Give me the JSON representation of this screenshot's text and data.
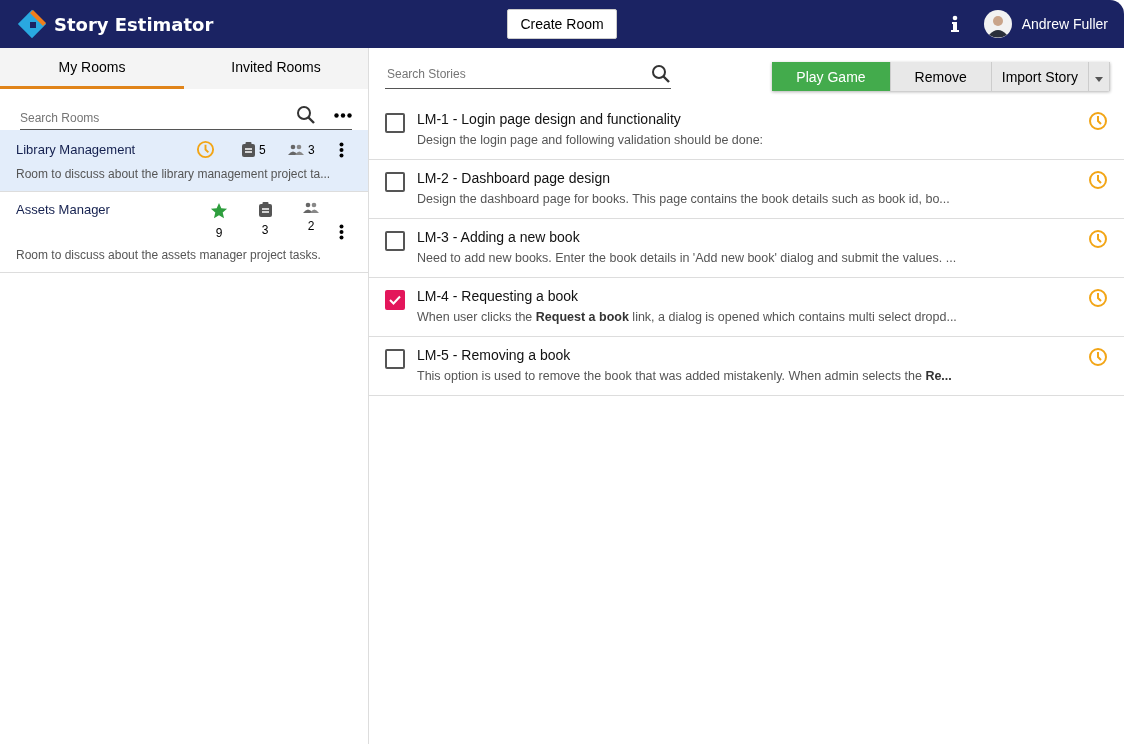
{
  "header": {
    "app_name": "Story Estimator",
    "create_button": "Create Room",
    "user_name": "Andrew Fuller"
  },
  "sidebar": {
    "tabs": [
      {
        "label": "My Rooms",
        "selected": true
      },
      {
        "label": "Invited Rooms",
        "selected": false
      }
    ],
    "search": {
      "placeholder": "Search Rooms"
    },
    "rooms": [
      {
        "name": "Library Management",
        "selected": true,
        "kind": "inline",
        "status": {
          "kind": "clock"
        },
        "stories": "5",
        "members": "3",
        "description": "Room to discuss about the library management project ta..."
      },
      {
        "name": "Assets Manager",
        "selected": false,
        "kind": "stacked",
        "status": {
          "kind": "star",
          "count": "9"
        },
        "stories": "3",
        "members": "2",
        "description": "Room to discuss about the assets manager project tasks."
      }
    ]
  },
  "main": {
    "search": {
      "placeholder": "Search Stories"
    },
    "buttons": [
      "Play Game",
      "Remove",
      "Import Story"
    ],
    "stories": [
      {
        "title": "LM-1 - Login page design and functionality",
        "checked": false,
        "description": "Design the login page and following validation should be done:"
      },
      {
        "title": "LM-2 - Dashboard page design",
        "checked": false,
        "description": "Design the dashboard page for books. This page contains the book details such as book id, bo..."
      },
      {
        "title": "LM-3 - Adding a new book",
        "checked": false,
        "description": "Need to add new books. Enter the book details in 'Add new book' dialog and submit the values. ..."
      },
      {
        "title": "LM-4 - Requesting a book",
        "checked": true,
        "description": "When user clicks the **Request a book** link, a dialog is opened which contains multi select dropd..."
      },
      {
        "title": "LM-5 - Removing a book",
        "checked": false,
        "description": "This option is used to remove the book that was added mistakenly. When admin selects the **Re...**"
      }
    ]
  }
}
